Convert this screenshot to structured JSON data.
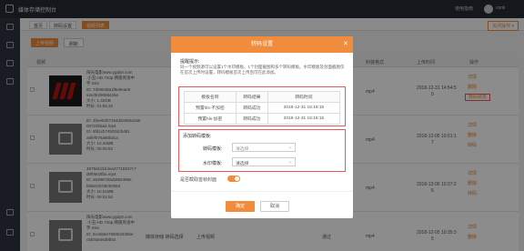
{
  "app": {
    "title": "媒体存储控制台",
    "messages": "",
    "help": "使用指南",
    "user": "conk"
  },
  "tabs": [
    "首页",
    "转码设置",
    "视频列表"
  ],
  "tab_more": "关闭操作 ▾",
  "toolbar": {
    "upload": "上传视频",
    "refresh": "刷新"
  },
  "table": {
    "headers": [
      "视频",
      "",
      "",
      "",
      "",
      "封装格式",
      "上传时间",
      "操作"
    ],
    "rows": [
      {
        "kind": "video",
        "info": [
          "阳光电影www.ygdy8.com",
          ".小丑.HD.720p.韩版英语中",
          "字.mkv",
          "ID: 7d09048a1f9e8eae5",
          "a2e3b29088425a",
          "大小: 1.42GB",
          "时长: 01:55:32"
        ],
        "format": "mp4",
        "time": "2018-12-31 14:54:5",
        "time2": "0",
        "ops": [
          "详情",
          "删除",
          "转码状态"
        ]
      },
      {
        "kind": "image",
        "info": [
          "ID: 4bee82b7164d2e6b5e2a5",
          "00722b6a4.mp4",
          "ID: 8fd1cb74b02dcb481",
          "a8fef576a80bdca",
          "大小: 12.44MB",
          "时长: 00:00:52"
        ],
        "format": "mp4",
        "time": "2018-12-05 10:51:1",
        "time2": "7",
        "ops": [
          "详情",
          "删除",
          "转码"
        ]
      },
      {
        "kind": "image",
        "info": [
          "3079d1d1b4ea47718537c7",
          "d0f0602fba.mp4",
          "ID: a63987d0ab984489e",
          "bb8e03c08262064",
          "大小: 10.01MB",
          "时长: 00:01:52"
        ],
        "format": "mp4",
        "time": "2018-12-05 10:37:2",
        "time2": "5",
        "ops": [
          "详情",
          "删除",
          "转码"
        ]
      },
      {
        "kind": "image",
        "info": [
          "阳光电影www.ygdy8.com",
          ".小丑.HD.720p.韩版英语中",
          "字.mkv",
          "ID: 8cc8b5e766084336be",
          "c5b3a846d9b52"
        ],
        "format": "mp4",
        "status": "媒体存储·转码选择",
        "status2": "上传视频",
        "status3": "通过",
        "time": "2018-12-05 10:35:3",
        "time2": "5",
        "ops": [
          "详情",
          "删除"
        ]
      }
    ]
  },
  "modal": {
    "title": "转码设置",
    "tip_title": "提醒提示:",
    "tip_text": "同一个视频源可以设置1个水印模板。1个封面截图和多个转码模板。水印模板及封面截图仅在首次上传时设置，转码模板首次上传后可在此添加。",
    "tpl_headers": [
      "模板名称",
      "转码结果",
      "转码时间"
    ],
    "tpl_rows": [
      {
        "name": "预置hls-不加密",
        "result": "转码成功",
        "time": "2018-12-31 15:18:15"
      },
      {
        "name": "预置hls-加密",
        "result": "转码成功",
        "time": "2018-12-31 15:18:15"
      }
    ],
    "add_title": "添加转码模板:",
    "tpl_label": "转码模板:",
    "tpl_placeholder": "请选择",
    "wm_label": "水印模板:",
    "wm_value": "请选择",
    "auto_label": "是否截取首帧封面",
    "ok": "确定",
    "cancel": "取消"
  }
}
